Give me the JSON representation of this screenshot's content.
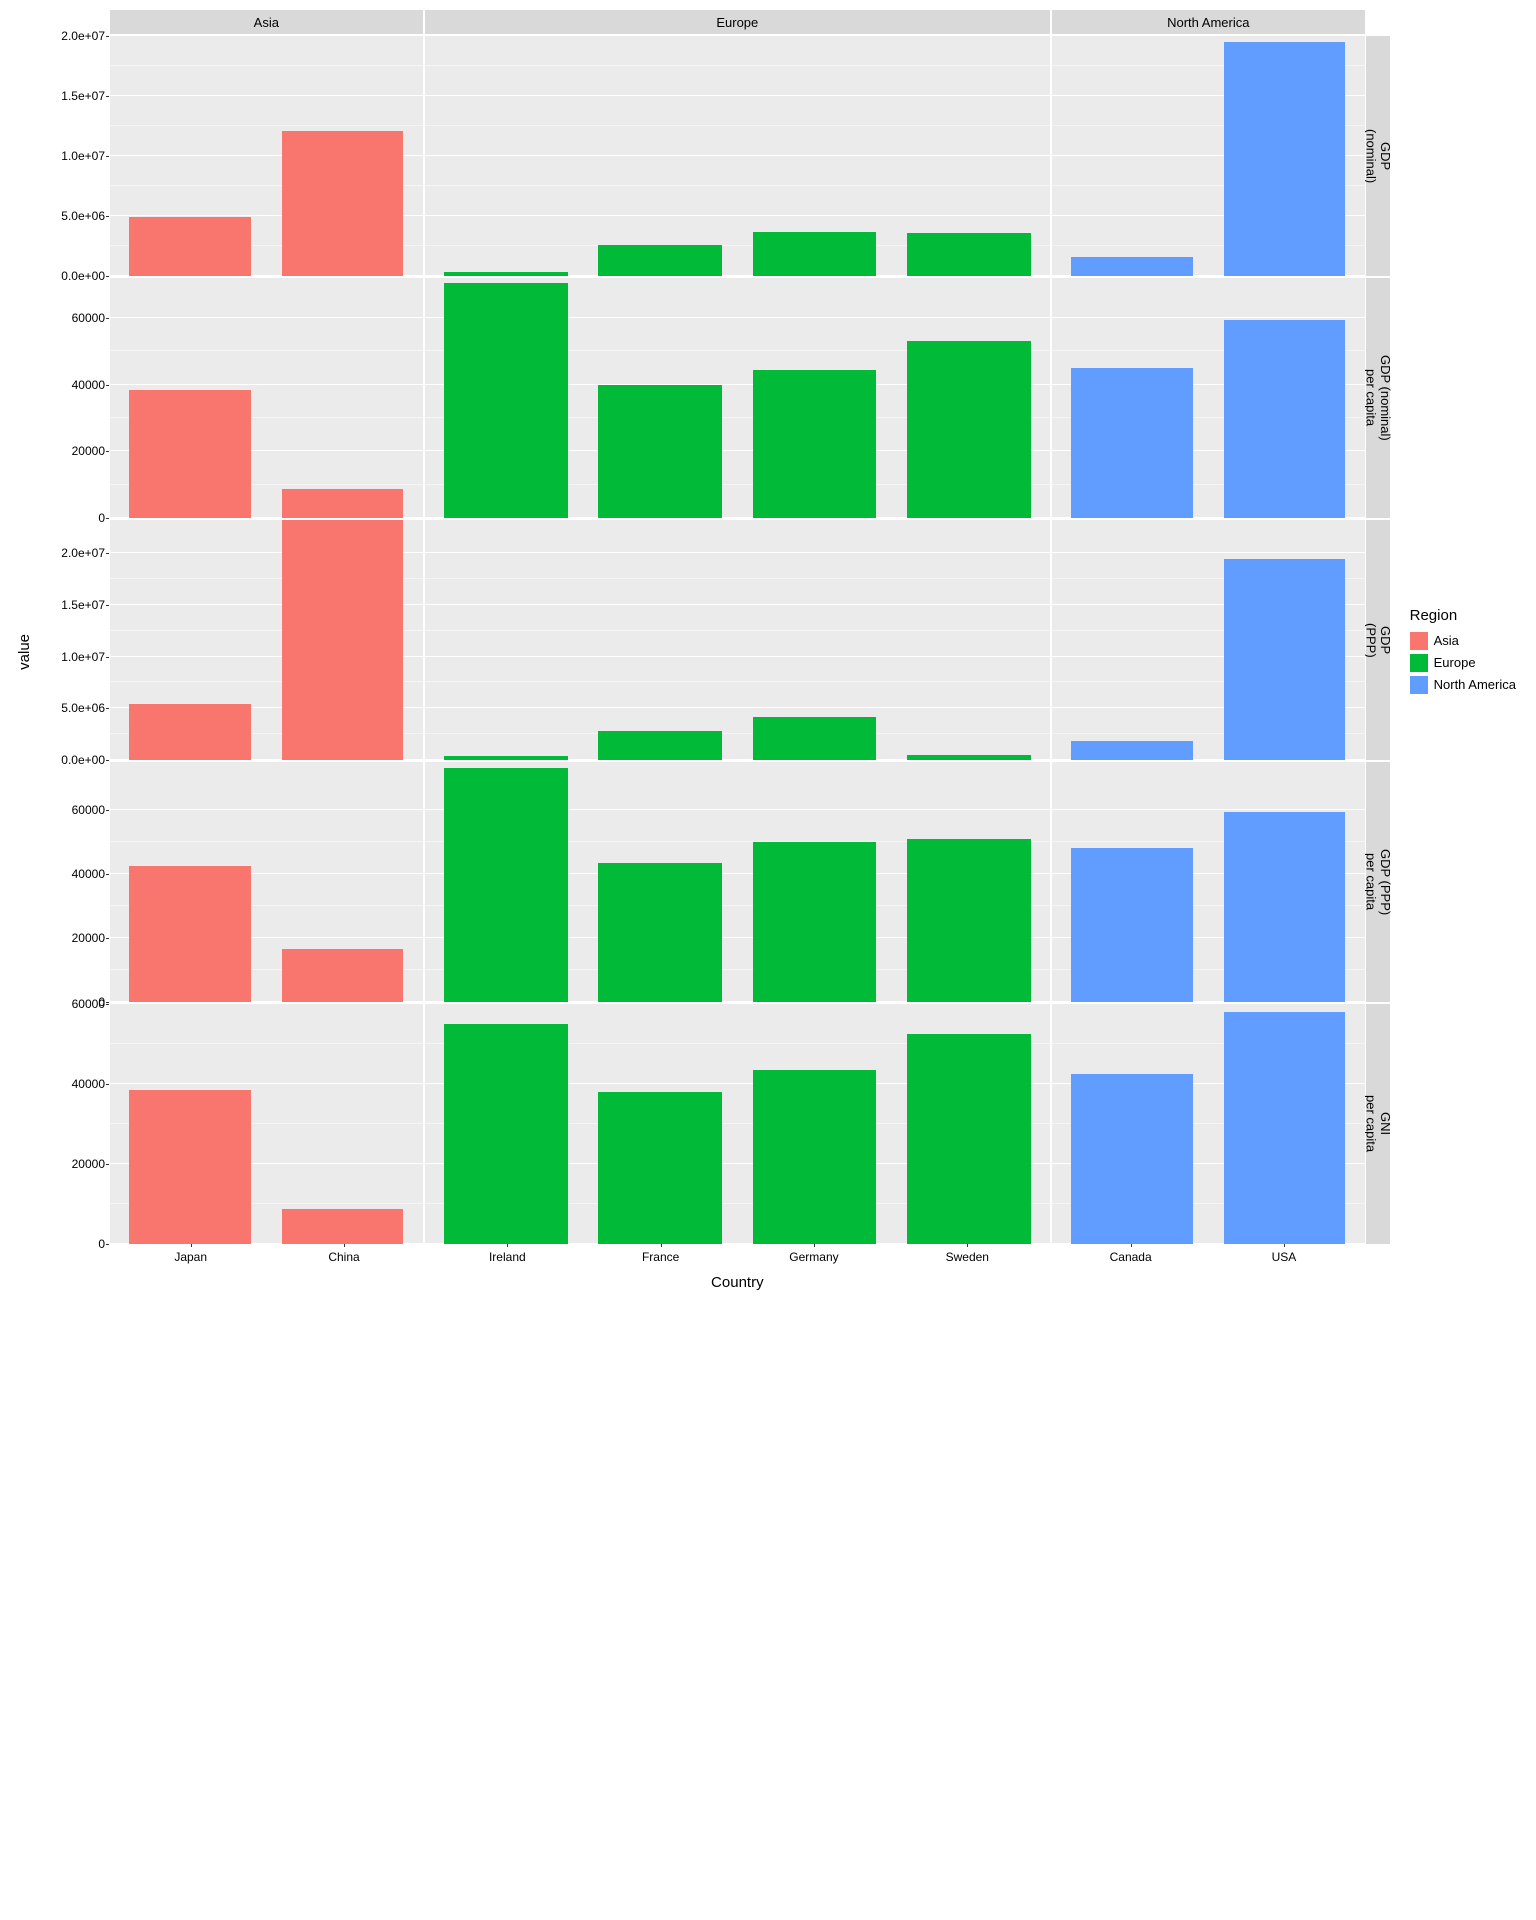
{
  "chart_data": {
    "type": "bar",
    "facet_cols": [
      "Asia",
      "Europe",
      "North America"
    ],
    "facet_rows": [
      "GDP (nominal)",
      "GDP (nominal) per capita",
      "GDP (PPP)",
      "GDP (PPP) per capita",
      "GNI per capita"
    ],
    "xlabel": "Country",
    "ylabel": "value",
    "legend_title": "Region",
    "regions": {
      "Asia": {
        "color": "#f8766d",
        "countries": [
          "Japan",
          "China"
        ]
      },
      "Europe": {
        "color": "#00ba38",
        "countries": [
          "Ireland",
          "France",
          "Germany",
          "Sweden"
        ]
      },
      "North America": {
        "color": "#619cff",
        "countries": [
          "Canada",
          "USA"
        ]
      }
    },
    "rows": [
      {
        "metric": "GDP (nominal)",
        "ymax": 20000000,
        "y_ticks": [
          0,
          5000000,
          10000000,
          15000000,
          20000000
        ],
        "y_tick_labels": [
          "0.0e+00",
          "5.0e+06",
          "1.0e+07",
          "1.5e+07",
          "2.0e+07"
        ],
        "values": {
          "Japan": 4900000,
          "China": 12100000,
          "Ireland": 300000,
          "France": 2600000,
          "Germany": 3700000,
          "Sweden": 3600000,
          "Canada": 1600000,
          "USA": 19500000
        }
      },
      {
        "metric": "GDP (nominal) per capita",
        "ymax": 72000,
        "y_ticks": [
          0,
          20000,
          40000,
          60000
        ],
        "y_tick_labels": [
          "0",
          "20000",
          "40000",
          "60000"
        ],
        "values": {
          "Japan": 38500,
          "China": 8600,
          "Ireland": 70500,
          "France": 40000,
          "Germany": 44500,
          "Sweden": 53000,
          "Canada": 45000,
          "USA": 59500
        }
      },
      {
        "metric": "GDP (PPP)",
        "ymax": 23200000,
        "y_ticks": [
          0,
          5000000,
          10000000,
          15000000,
          20000000
        ],
        "y_tick_labels": [
          "0.0e+00",
          "5.0e+06",
          "1.0e+07",
          "1.5e+07",
          "2.0e+07"
        ],
        "values": {
          "Japan": 5400000,
          "China": 23200000,
          "Ireland": 350000,
          "France": 2800000,
          "Germany": 4200000,
          "Sweden": 500000,
          "Canada": 1800000,
          "USA": 19400000
        }
      },
      {
        "metric": "GDP (PPP) per capita",
        "ymax": 75000,
        "y_ticks": [
          0,
          20000,
          40000,
          60000
        ],
        "y_tick_labels": [
          "0",
          "20000",
          "40000",
          "60000"
        ],
        "values": {
          "Japan": 42500,
          "China": 16500,
          "Ireland": 73000,
          "France": 43500,
          "Germany": 50000,
          "Sweden": 51000,
          "Canada": 48000,
          "USA": 59500
        }
      },
      {
        "metric": "GNI per capita",
        "ymax": 60000,
        "y_ticks": [
          0,
          20000,
          40000,
          60000
        ],
        "y_tick_labels": [
          "0",
          "20000",
          "40000",
          "60000"
        ],
        "values": {
          "Japan": 38500,
          "China": 8700,
          "Ireland": 55000,
          "France": 37970,
          "Germany": 43500,
          "Sweden": 52500,
          "Canada": 42500,
          "USA": 58000
        }
      }
    ]
  },
  "row_strip_html": {
    "0": "GDP<br>(nominal)",
    "1": "GDP (nominal)<br>per capita",
    "2": "GDP<br>(PPP)",
    "3": "GDP (PPP)<br>per capita",
    "4": "GNI<br>per capita"
  }
}
